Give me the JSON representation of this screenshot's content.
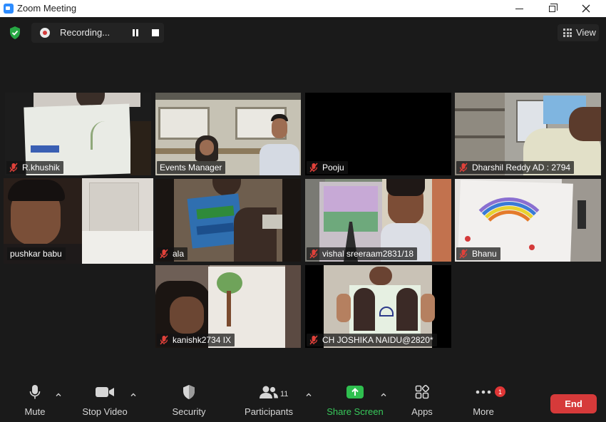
{
  "window": {
    "title": "Zoom Meeting"
  },
  "recording": {
    "label": "Recording..."
  },
  "view": {
    "label": "View"
  },
  "participants": [
    {
      "name": "R.khushik",
      "muted": true
    },
    {
      "name": "Events Manager",
      "muted": false
    },
    {
      "name": "Pooju",
      "muted": true
    },
    {
      "name": "Dharshil Reddy AD : 2794",
      "muted": true
    },
    {
      "name": "pushkar babu",
      "muted": false,
      "speaking": true
    },
    {
      "name": "ala",
      "muted": true
    },
    {
      "name": "vishal sreeraam2831/18",
      "muted": true
    },
    {
      "name": "Bhanu",
      "muted": true
    },
    {
      "name": "kanishk2734 IX",
      "muted": true
    },
    {
      "name": "CH JOSHIKA NAIDU@2820*",
      "muted": true
    }
  ],
  "toolbar": {
    "mute": "Mute",
    "stop_video": "Stop Video",
    "security": "Security",
    "participants": "Participants",
    "participants_count": "11",
    "share_screen": "Share Screen",
    "apps": "Apps",
    "more": "More",
    "more_badge": "1",
    "end": "End"
  },
  "colors": {
    "accent_green": "#38c85b",
    "end_red": "#d63a3a",
    "active_speaker": "#e8e27a",
    "muted_red": "#e0413a"
  }
}
